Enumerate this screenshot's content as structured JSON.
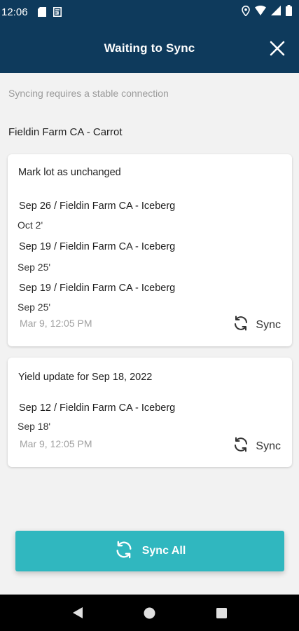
{
  "status_bar": {
    "time": "12:06",
    "icons": [
      "sd-card-icon",
      "storage-icon",
      "location-icon",
      "wifi-icon",
      "signal-icon",
      "battery-icon"
    ]
  },
  "app_bar": {
    "title": "Waiting to Sync",
    "close_icon": "close-icon"
  },
  "subtitle": "Syncing requires a stable connection",
  "group_title": "Fieldin Farm CA - Carrot",
  "cards": [
    {
      "title": "Mark lot as unchanged",
      "entries": [
        {
          "lot": "Sep 26 / Fieldin Farm CA - Iceberg",
          "date": "Oct 2'"
        },
        {
          "lot": "Sep 19 / Fieldin Farm CA - Iceberg",
          "date": "Sep 25'"
        },
        {
          "lot": "Sep 19 / Fieldin Farm CA - Iceberg",
          "date": "Sep 25'"
        }
      ],
      "timestamp": "Mar 9, 12:05 PM",
      "sync_label": "Sync"
    },
    {
      "title": "Yield update for Sep 18, 2022",
      "entries": [
        {
          "lot": "Sep 12 / Fieldin Farm CA - Iceberg",
          "date": "Sep 18'"
        }
      ],
      "timestamp": "Mar 9, 12:05 PM",
      "sync_label": "Sync"
    }
  ],
  "sync_all_label": "Sync All",
  "colors": {
    "header": "#0e3a5c",
    "accent": "#30b7bf",
    "background": "#f2f2f2"
  }
}
